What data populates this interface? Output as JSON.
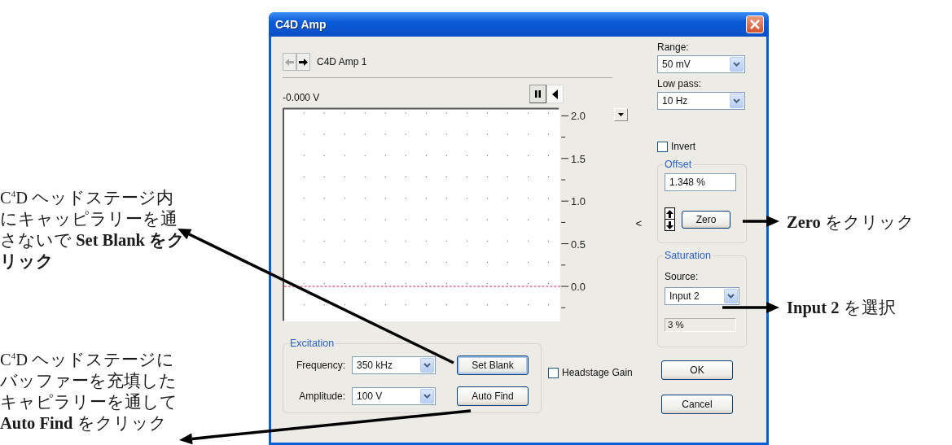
{
  "window": {
    "title": "C4D Amp"
  },
  "navigation": [
    {
      "kind": "back",
      "disabled": true
    },
    {
      "kind": "forward",
      "disabled": false
    }
  ],
  "device": "C4D Amp 1",
  "reading": "-0.000 V",
  "playback": [
    {
      "kind": "pause",
      "selected": false
    },
    {
      "kind": "play",
      "selected": true
    }
  ],
  "plot": {
    "y_ticks": [
      "2.0",
      "1.5",
      "1.0",
      "0.5",
      "0.0"
    ]
  },
  "offset_marker": "<",
  "range": {
    "label": "Range:",
    "value": "50 mV"
  },
  "low_pass": {
    "label": "Low pass:",
    "value": "10 Hz"
  },
  "invert": {
    "label": "Invert",
    "checked": false
  },
  "offset": {
    "title": "Offset",
    "value": "1.348 %",
    "zero": "Zero"
  },
  "saturation": {
    "title": "Saturation",
    "source_label": "Source:",
    "source": "Input 2",
    "readout": "3 %"
  },
  "excitation": {
    "title": "Excitation",
    "frequency": {
      "label": "Frequency:",
      "value": "350 kHz"
    },
    "amplitude": {
      "label": "Amplitude:",
      "value": "100 V"
    },
    "set_blank": "Set Blank",
    "auto_find": "Auto Find"
  },
  "headstage_gain": {
    "label": "Headstage Gain",
    "checked": false
  },
  "buttons": [
    "OK",
    "Cancel"
  ],
  "annotations": [
    {
      "text": "C$^{4}$D ヘッドステージ内にキャッピラリーを通さないで **Set Blank をクリック**"
    },
    {
      "text": "C$^{4}$D ヘッドステージにバッファーを充填したキャピラリーを通して **Auto Find** をクリック"
    },
    {
      "text": "**Zero** をクリック"
    },
    {
      "text": "**Input 2** を選択"
    }
  ]
}
